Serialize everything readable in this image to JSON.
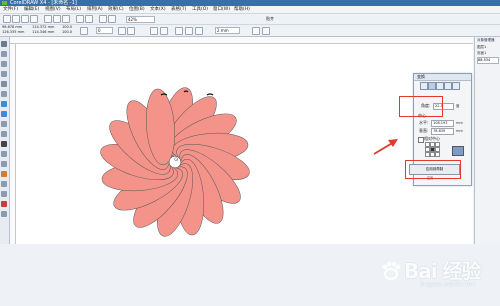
{
  "window": {
    "title": "CorelDRAW X4 - [未命名 -1]"
  },
  "menu": [
    "文件(F)",
    "编辑(E)",
    "视图(V)",
    "布局(L)",
    "排列(A)",
    "效果(C)",
    "位图(B)",
    "文本(X)",
    "表格(T)",
    "工具(O)",
    "窗口(W)",
    "帮助(H)"
  ],
  "toolbar": {
    "zoom_value": "42%",
    "snap_label": "贴齐",
    "x_value": "96.678 mm",
    "y_value": "126.335 mm",
    "w_value": "114.372 mm",
    "h_value": "114.346 mm",
    "scale_w": "100.0",
    "scale_h": "100.0",
    "angle_value": "0",
    "outline_value": "2 mm"
  },
  "dialog": {
    "title": "变换",
    "angle_label": "角度:",
    "angle_value": "22.5",
    "angle_unit": "度",
    "center_label": "中心",
    "h_label": "水平:",
    "h_value": "108.193",
    "v_label": "垂直:",
    "v_value": "78.839",
    "unit": "mm",
    "relative_label": "相对中心",
    "apply_label": "应用到再制",
    "apply_sub": "应用"
  },
  "docker": {
    "title": "对象管理器",
    "line1": "图层1",
    "line2": "页面1",
    "field": "88.534"
  },
  "flower": {
    "petal_count": 16,
    "petal_color": "#f4938a",
    "petal_stroke": "#555555"
  },
  "colors": {
    "highlight": "#e23a2a",
    "arrow": "#e23a2a"
  },
  "watermark": {
    "text": "Bai 经验",
    "sub": "jingyan.baidu.com"
  }
}
